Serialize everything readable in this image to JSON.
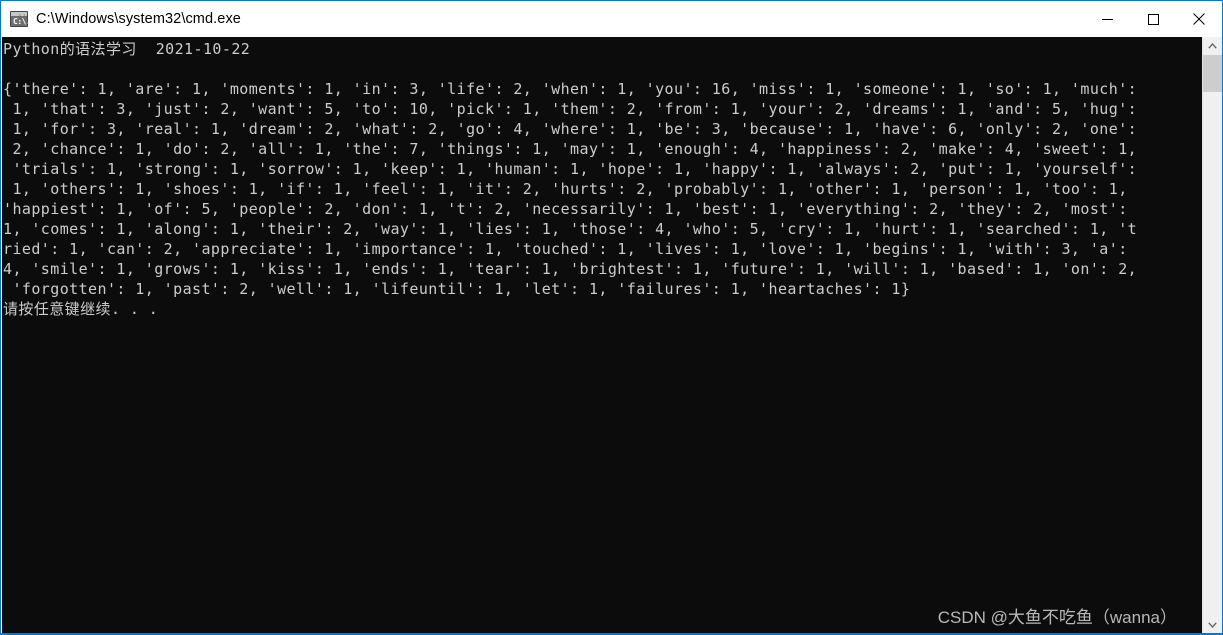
{
  "window": {
    "title": "C:\\Windows\\system32\\cmd.exe",
    "icon": "cmd-console-icon",
    "icon_prompt_text": "C:\\.",
    "accent_color": "#0078d7",
    "console_bg": "#0c0c0c",
    "console_fg": "#cccccc",
    "controls": {
      "minimize_label": "Minimize",
      "maximize_label": "Maximize",
      "close_label": "Close"
    }
  },
  "console": {
    "lines": [
      "Python的语法学习  2021-10-22",
      "",
      "{'there': 1, 'are': 1, 'moments': 1, 'in': 3, 'life': 2, 'when': 1, 'you': 16, 'miss': 1, 'someone': 1, 'so': 1, 'much':",
      " 1, 'that': 3, 'just': 2, 'want': 5, 'to': 10, 'pick': 1, 'them': 2, 'from': 1, 'your': 2, 'dreams': 1, 'and': 5, 'hug':",
      " 1, 'for': 3, 'real': 1, 'dream': 2, 'what': 2, 'go': 4, 'where': 1, 'be': 3, 'because': 1, 'have': 6, 'only': 2, 'one':",
      " 2, 'chance': 1, 'do': 2, 'all': 1, 'the': 7, 'things': 1, 'may': 1, 'enough': 4, 'happiness': 2, 'make': 4, 'sweet': 1,",
      " 'trials': 1, 'strong': 1, 'sorrow': 1, 'keep': 1, 'human': 1, 'hope': 1, 'happy': 1, 'always': 2, 'put': 1, 'yourself':",
      " 1, 'others': 1, 'shoes': 1, 'if': 1, 'feel': 1, 'it': 2, 'hurts': 2, 'probably': 1, 'other': 1, 'person': 1, 'too': 1,",
      "'happiest': 1, 'of': 5, 'people': 2, 'don': 1, 't': 2, 'necessarily': 1, 'best': 1, 'everything': 2, 'they': 2, 'most':",
      "1, 'comes': 1, 'along': 1, 'their': 2, 'way': 1, 'lies': 1, 'those': 4, 'who': 5, 'cry': 1, 'hurt': 1, 'searched': 1, 't",
      "ried': 1, 'can': 2, 'appreciate': 1, 'importance': 1, 'touched': 1, 'lives': 1, 'love': 1, 'begins': 1, 'with': 3, 'a':",
      "4, 'smile': 1, 'grows': 1, 'kiss': 1, 'ends': 1, 'tear': 1, 'brightest': 1, 'future': 1, 'will': 1, 'based': 1, 'on': 2,",
      " 'forgotten': 1, 'past': 2, 'well': 1, 'lifeuntil': 1, 'let': 1, 'failures': 1, 'heartaches': 1}",
      "请按任意键继续. . ."
    ]
  },
  "scrollbar": {
    "up_arrow": "chevron-up-icon",
    "down_arrow": "chevron-down-icon",
    "thumb_label": "scrollbar-thumb"
  },
  "watermark": {
    "text": "CSDN @大鱼不吃鱼（wanna）"
  }
}
